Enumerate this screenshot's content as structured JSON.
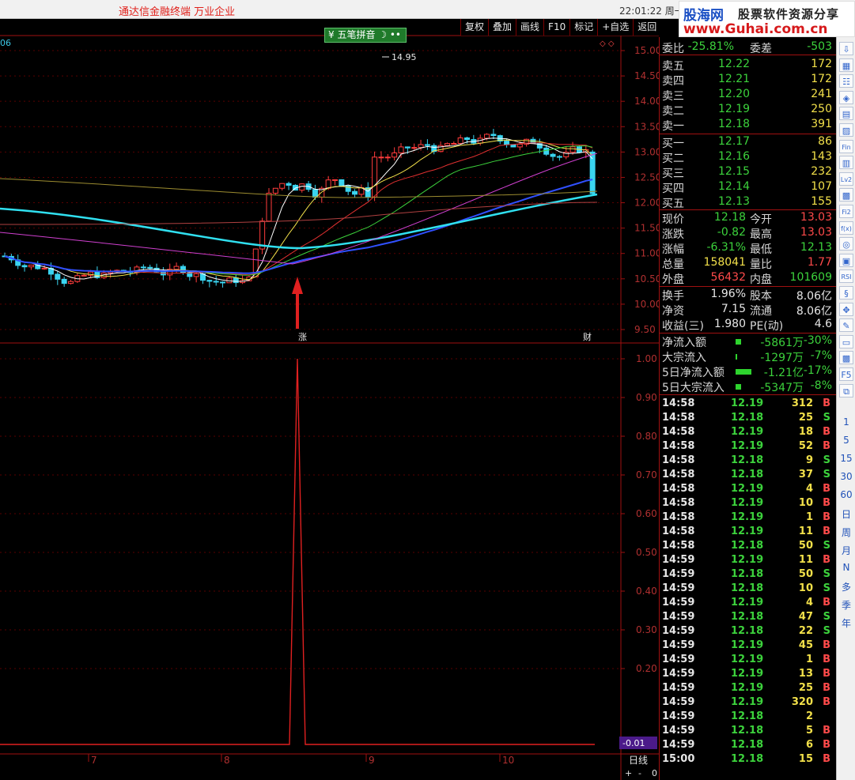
{
  "title_bar": {
    "app_title": "通达信金融终端    万业企业",
    "clock": "22:01:22 周一",
    "logo_main": "股海网",
    "logo_sub": "股票软件资源分享",
    "logo_url": "www.Guhai.com.cn"
  },
  "chart": {
    "toolbar": [
      "复权",
      "叠加",
      "画线",
      "F10",
      "标记",
      "+自选",
      "返回"
    ],
    "ime_label": "五笔拼音",
    "corner_label": "06",
    "high_annotation": "14.95",
    "signal_label": "涨",
    "event_label": "财",
    "price_axis": [
      "15.00",
      "14.50",
      "14.00",
      "13.50",
      "13.00",
      "12.50",
      "12.00",
      "11.50",
      "11.00",
      "10.50",
      "10.00",
      "9.50"
    ],
    "indicator_axis": [
      "1.00",
      "0.90",
      "0.80",
      "0.70",
      "0.60",
      "0.50",
      "0.40",
      "0.30",
      "0.20"
    ],
    "indicator_readout": "-0.01",
    "date_axis": [
      "7",
      "8",
      "9",
      "10"
    ],
    "period_label": "日线",
    "zoom_controls": [
      "+",
      "-",
      "0"
    ]
  },
  "chart_data": {
    "type": "candlestick",
    "price_range": [
      9.3,
      15.2
    ],
    "indicator_range": [
      0,
      1
    ],
    "signal_value": 1.0
  },
  "quote": {
    "weibi": {
      "label": "委比",
      "value": "-25.81%",
      "label2": "委差",
      "value2": "-503"
    },
    "asks": [
      {
        "label": "卖五",
        "price": "12.22",
        "vol": "172"
      },
      {
        "label": "卖四",
        "price": "12.21",
        "vol": "172"
      },
      {
        "label": "卖三",
        "price": "12.20",
        "vol": "241"
      },
      {
        "label": "卖二",
        "price": "12.19",
        "vol": "250"
      },
      {
        "label": "卖一",
        "price": "12.18",
        "vol": "391"
      }
    ],
    "bids": [
      {
        "label": "买一",
        "price": "12.17",
        "vol": "86"
      },
      {
        "label": "买二",
        "price": "12.16",
        "vol": "143"
      },
      {
        "label": "买三",
        "price": "12.15",
        "vol": "232"
      },
      {
        "label": "买四",
        "price": "12.14",
        "vol": "107"
      },
      {
        "label": "买五",
        "price": "12.13",
        "vol": "155"
      }
    ],
    "stats": [
      {
        "l1": "现价",
        "v1": "12.18",
        "c1": "grn",
        "l2": "今开",
        "v2": "13.03",
        "c2": "red"
      },
      {
        "l1": "涨跌",
        "v1": "-0.82",
        "c1": "grn",
        "l2": "最高",
        "v2": "13.03",
        "c2": "red"
      },
      {
        "l1": "涨幅",
        "v1": "-6.31%",
        "c1": "grn",
        "l2": "最低",
        "v2": "12.13",
        "c2": "grn"
      },
      {
        "l1": "总量",
        "v1": "158041",
        "c1": "yel",
        "l2": "量比",
        "v2": "1.77",
        "c2": "red"
      },
      {
        "l1": "外盘",
        "v1": "56432",
        "c1": "red",
        "l2": "内盘",
        "v2": "101609",
        "c2": "grn"
      }
    ],
    "stats2": [
      {
        "l1": "换手",
        "v1": "1.96%",
        "l2": "股本",
        "v2": "8.06亿"
      },
      {
        "l1": "净资",
        "v1": "7.15",
        "l2": "流通",
        "v2": "8.06亿"
      },
      {
        "l1": "收益(三)",
        "v1": "1.980",
        "l2": "PE(动)",
        "v2": "4.6"
      }
    ],
    "flows": [
      {
        "label": "净流入额",
        "value": "-5861万",
        "pct": "-30%"
      },
      {
        "label": "大宗流入",
        "value": "-1297万",
        "pct": "-7%"
      },
      {
        "label": "5日净流入额",
        "value": "-1.21亿",
        "pct": "-17%"
      },
      {
        "label": "5日大宗流入",
        "value": "-5347万",
        "pct": "-8%"
      }
    ],
    "flow_bar_fractions": [
      0.3,
      0.07,
      0.85,
      0.3
    ]
  },
  "ticks": [
    {
      "t": "14:58",
      "p": "12.19",
      "v": "312",
      "s": "B"
    },
    {
      "t": "14:58",
      "p": "12.18",
      "v": "25",
      "s": "S"
    },
    {
      "t": "14:58",
      "p": "12.19",
      "v": "18",
      "s": "B"
    },
    {
      "t": "14:58",
      "p": "12.19",
      "v": "52",
      "s": "B"
    },
    {
      "t": "14:58",
      "p": "12.18",
      "v": "9",
      "s": "S"
    },
    {
      "t": "14:58",
      "p": "12.18",
      "v": "37",
      "s": "S"
    },
    {
      "t": "14:58",
      "p": "12.19",
      "v": "4",
      "s": "B"
    },
    {
      "t": "14:58",
      "p": "12.19",
      "v": "10",
      "s": "B"
    },
    {
      "t": "14:58",
      "p": "12.19",
      "v": "1",
      "s": "B"
    },
    {
      "t": "14:58",
      "p": "12.19",
      "v": "11",
      "s": "B"
    },
    {
      "t": "14:58",
      "p": "12.18",
      "v": "50",
      "s": "S"
    },
    {
      "t": "14:59",
      "p": "12.19",
      "v": "11",
      "s": "B"
    },
    {
      "t": "14:59",
      "p": "12.18",
      "v": "50",
      "s": "S"
    },
    {
      "t": "14:59",
      "p": "12.18",
      "v": "10",
      "s": "S"
    },
    {
      "t": "14:59",
      "p": "12.19",
      "v": "4",
      "s": "B"
    },
    {
      "t": "14:59",
      "p": "12.18",
      "v": "47",
      "s": "S"
    },
    {
      "t": "14:59",
      "p": "12.18",
      "v": "22",
      "s": "S"
    },
    {
      "t": "14:59",
      "p": "12.19",
      "v": "45",
      "s": "B"
    },
    {
      "t": "14:59",
      "p": "12.19",
      "v": "1",
      "s": "B"
    },
    {
      "t": "14:59",
      "p": "12.19",
      "v": "13",
      "s": "B"
    },
    {
      "t": "14:59",
      "p": "12.19",
      "v": "25",
      "s": "B"
    },
    {
      "t": "14:59",
      "p": "12.19",
      "v": "320",
      "s": "B"
    },
    {
      "t": "14:59",
      "p": "12.18",
      "v": "2",
      "s": ""
    },
    {
      "t": "14:59",
      "p": "12.18",
      "v": "5",
      "s": "B"
    },
    {
      "t": "14:59",
      "p": "12.18",
      "v": "6",
      "s": "B"
    },
    {
      "t": "15:00",
      "p": "12.18",
      "v": "15",
      "s": "B"
    }
  ],
  "side_icons": [
    "⇩",
    "▦",
    "☷",
    "◈",
    "▤",
    "▨",
    "Fin",
    "▥",
    "Lv2",
    "▩",
    "Fi2",
    "f(x)",
    "◎",
    "▣",
    "RSI",
    "§",
    "✥",
    "✎",
    "▭",
    "▩",
    "F5",
    "⧉"
  ],
  "side_periods": [
    "1",
    "5",
    "15",
    "30",
    "60",
    "日",
    "周",
    "月",
    "N",
    "多",
    "季",
    "年"
  ],
  "colors": {
    "up": "#ff3c3c",
    "down": "#3ad4f0",
    "accent": "#a01010"
  }
}
